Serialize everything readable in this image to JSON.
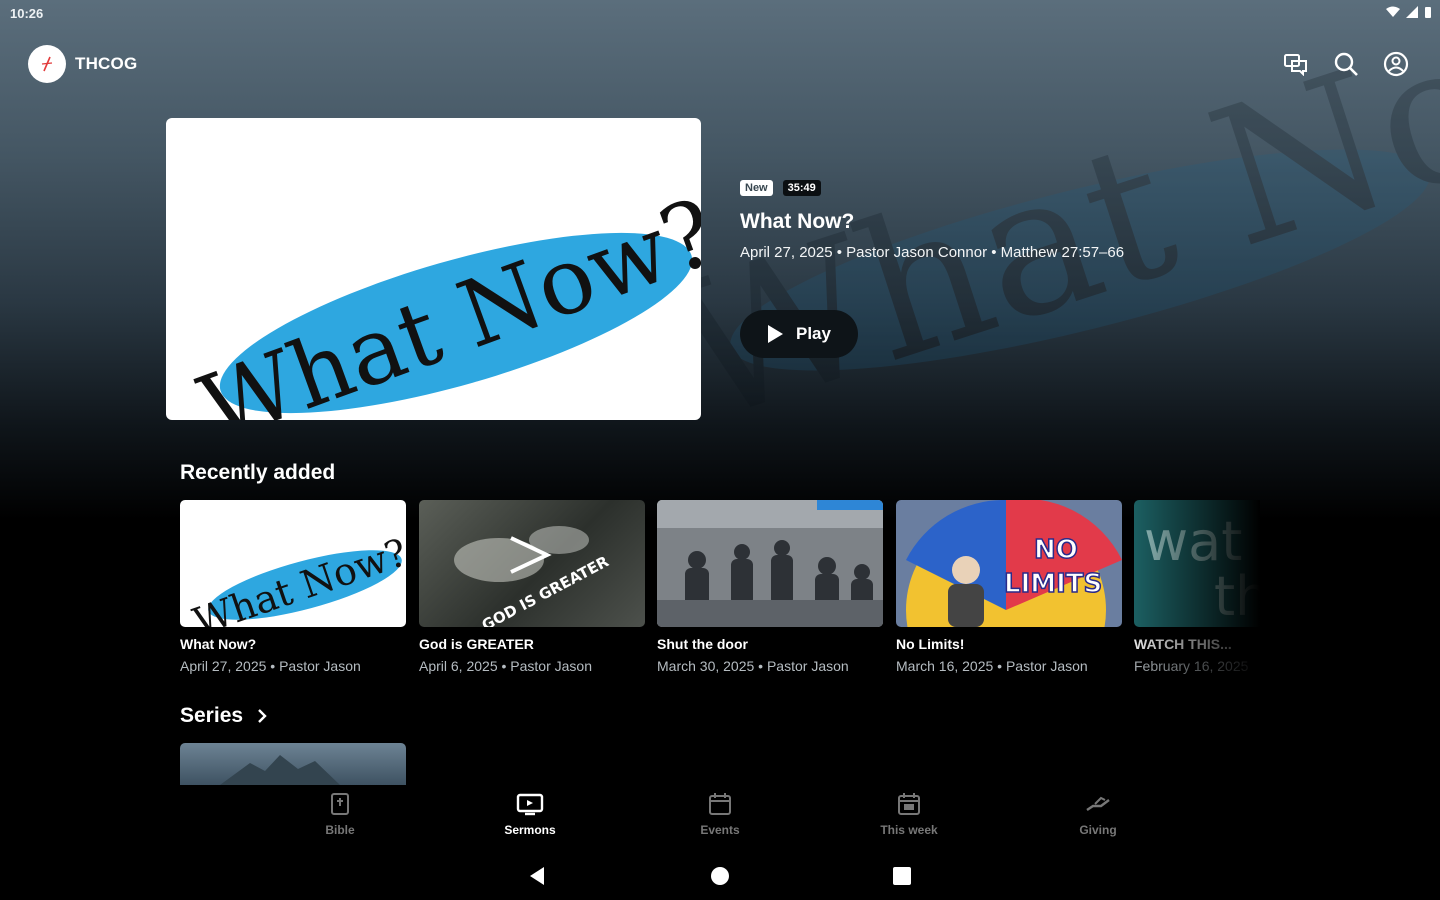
{
  "status": {
    "time": "10:26"
  },
  "app": {
    "brand": "THCOG"
  },
  "hero": {
    "badge_new": "New",
    "duration": "35:49",
    "title": "What Now?",
    "meta": "April 27, 2025 • Pastor Jason Connor  • Matthew 27:57–66",
    "play_label": "Play",
    "art_text": "What Now?"
  },
  "recently_added": {
    "title": "Recently added",
    "items": [
      {
        "title": "What Now?",
        "meta": "April 27, 2025 • Pastor Jason",
        "art": "What Now?"
      },
      {
        "title": "God is GREATER",
        "meta": "April 6, 2025 • Pastor Jason",
        "art": "GOD IS GREATER"
      },
      {
        "title": "Shut the door",
        "meta": "March 30, 2025 • Pastor Jason",
        "art": ""
      },
      {
        "title": "No Limits!",
        "meta": "March 16, 2025 • Pastor Jason",
        "art_line1": "NO",
        "art_line2": "LIMITS"
      },
      {
        "title": "WATCH THIS...",
        "meta": "February 16, 2025",
        "art_line1": "wat",
        "art_line2": "th"
      }
    ]
  },
  "series": {
    "title": "Series"
  },
  "nav": [
    {
      "label": "Bible",
      "icon": "bible-icon"
    },
    {
      "label": "Sermons",
      "icon": "sermons-tv-icon",
      "active": true
    },
    {
      "label": "Events",
      "icon": "calendar-icon"
    },
    {
      "label": "This week",
      "icon": "calendar-week-icon"
    },
    {
      "label": "Giving",
      "icon": "giving-hand-icon"
    }
  ],
  "colors": {
    "accent_blue": "#2ea7e0",
    "nav_inactive": "#777777"
  }
}
